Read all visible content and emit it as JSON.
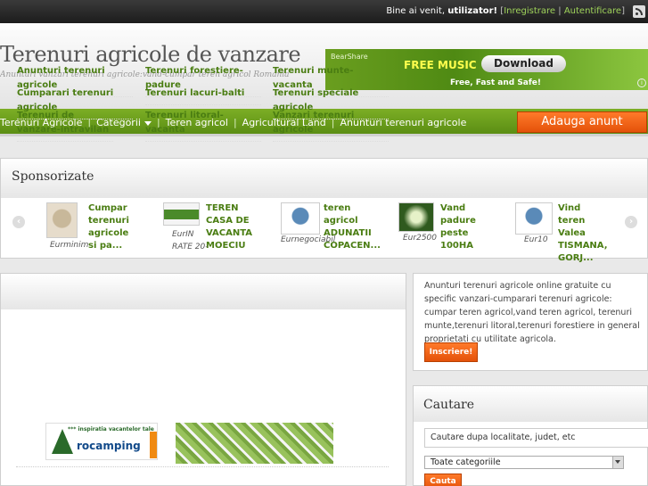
{
  "topbar": {
    "welcome": "Bine ai venit,",
    "user": "utilizator!",
    "bracket_open": "[",
    "bracket_close": "]",
    "register": "Inregistrare",
    "separator": "|",
    "login": "Autentificare",
    "rss_icon": "rss-icon"
  },
  "header": {
    "title": "Terenuri agricole de vanzare",
    "tagline": "Anunturi vanzari terenuri agricole:vand-cumpar teren agricol Romania"
  },
  "ad": {
    "brand": "BearShare",
    "free": "FREE MUSIC",
    "download": "Download",
    "fast": "Free, Fast and Safe!",
    "info": "i"
  },
  "nav": {
    "items": [
      "Terenuri Agricole",
      "Categorii",
      "Teren agricol",
      "Agricultural Land",
      "Anunturi terenuri agricole"
    ],
    "separator": "|",
    "add_button": "Adauga anunt"
  },
  "sponsored": {
    "title": "Sponsorizate",
    "prev": "‹",
    "next": "›",
    "items": [
      {
        "title": "Cumpar terenuri agricole si pa...",
        "price": "Eurminim"
      },
      {
        "title": "TEREN CASA DE VACANTA MOECIU",
        "price": "EurIN RATE 20-"
      },
      {
        "title": "teren agricol ADUNATII COPACEN...",
        "price": "Eurnegociabil"
      },
      {
        "title": "Vand padure peste 100HA",
        "price": "Eur2500"
      },
      {
        "title": "Vind teren Valea TISMANA, GORJ...",
        "price": "Eur10"
      }
    ]
  },
  "categories": [
    "Anunturi terenuri agricole",
    "Terenuri forestiere-padure",
    "Terenuri munte-vacanta",
    "Cumparari terenuri agricole",
    "Terenuri lacuri-balti",
    "Terenuri speciale agricole",
    "Terenuri de vanzare-intravilan",
    "Terenuri litoral-vacanta",
    "Vanzari terenuri agricole"
  ],
  "banner": {
    "tag": "*** inspiratia vacantelor tale",
    "name": "rocamping"
  },
  "about": {
    "text": "Anunturi terenuri agricole online gratuite cu specific vanzari-cumparari terenuri agricole: cumpar teren agricol,vand teren agricol, terenuri munte,terenuri litoral,terenuri forestiere in general proprietati cu utilitate agricola.",
    "button": "Inscriere!"
  },
  "search": {
    "title": "Cautare",
    "input_value": "Cautare dupa localitate, judet, etc",
    "category_selected": "Toate categoriile",
    "button": "Cauta"
  },
  "colors": {
    "nav_green": "#6a9e1e",
    "link_green": "#4a7d12",
    "accent_orange": "#f26a1b",
    "topbar": "#2b2b2b"
  }
}
